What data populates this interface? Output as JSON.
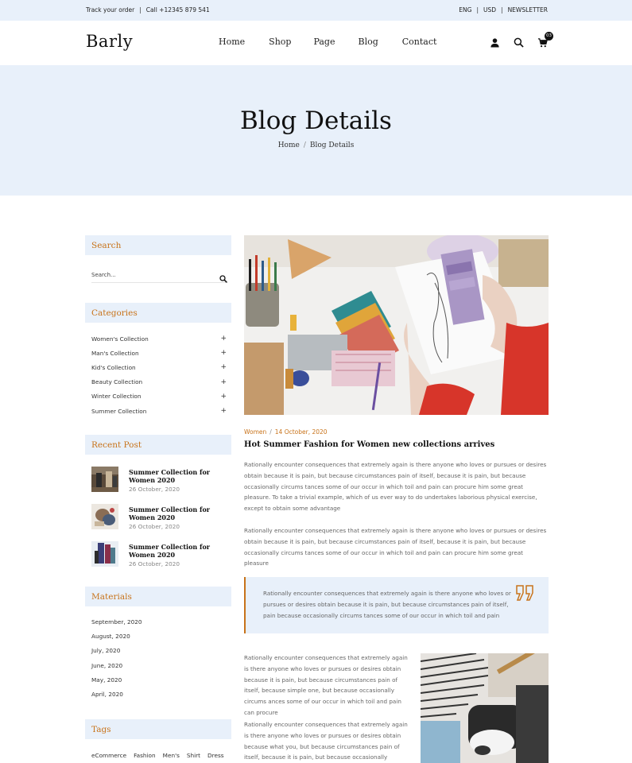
{
  "topbar": {
    "track_order": "Track your order",
    "call": "Call +12345 879 541",
    "lang": "ENG",
    "currency": "USD",
    "newsletter": "NEWSLETTER"
  },
  "header": {
    "logo": "Barly",
    "nav": [
      "Home",
      "Shop",
      "Page",
      "Blog",
      "Contact"
    ],
    "cart_count": "03",
    "icons": [
      "user-icon",
      "search-icon",
      "cart-icon"
    ]
  },
  "hero": {
    "title": "Blog Details",
    "breadcrumb": [
      "Home",
      "Blog Details"
    ]
  },
  "sidebar": {
    "search": {
      "title": "Search",
      "placeholder": "Search..."
    },
    "categories": {
      "title": "Categories",
      "items": [
        "Women's Collection",
        "Man's Collection",
        "Kid's Collection",
        "Beauty Collection",
        "Winter Collection",
        "Summer Collection"
      ]
    },
    "recent": {
      "title": "Recent Post",
      "items": [
        {
          "title": "Summer Collection for Women 2020",
          "date": "26 October, 2020"
        },
        {
          "title": "Summer Collection for Women 2020",
          "date": "26 October, 2020"
        },
        {
          "title": "Summer Collection for Women 2020",
          "date": "26 October, 2020"
        }
      ]
    },
    "materials": {
      "title": "Materials",
      "items": [
        "September, 2020",
        "August, 2020",
        "July, 2020",
        "June, 2020",
        "May, 2020",
        "April, 2020"
      ]
    },
    "tags": {
      "title": "Tags",
      "items": [
        "eCommerce",
        "Fashion",
        "Men's",
        "Shirt",
        "Dress"
      ]
    }
  },
  "post": {
    "category": "Women",
    "date": "14 October, 2020",
    "title": "Hot Summer Fashion for Women new collections arrives",
    "para1": "Rationally encounter consequences that extremely again is there anyone who loves or pursues or desires obtain because it is pain, but because circumstances pain of itself, because it is pain, but because occasionally circums tances some of our occur in which toil and pain can procure him some great pleasure. To take a trivial example, which of us ever way to do undertakes laborious physical exercise, except to obtain some advantage",
    "para2": "Rationally encounter consequences that extremely again is there anyone who loves or pursues or desires obtain because it is pain, but because circumstances pain of itself, because it is pain, but because occasionally circums tances some of our occur in which toil and pain can procure him some great pleasure",
    "quote": "Rationally encounter consequences that extremely again is there anyone who loves or pursues or desires obtain because it is pain, but because circumstances pain of itself, pain because occasionally circums tances some of our occur in which toil and pain",
    "col1": "Rationally encounter consequences that extremely again is there anyone who loves or pursues or desires obtain because it is pain, but because circumstances pain of itself, because simple one, but because occasionally circums ances some of our occur in which toil and pain can procure",
    "col2": "Rationally encounter consequences that extremely again is there anyone who loves or pursues or desires obtain because what you, but because circumstances pain of itself, because it is pain, but because occasionally circums"
  },
  "colors": {
    "accent": "#c8731a",
    "light_bg": "#e8f0fa",
    "text_dark": "#111111"
  }
}
